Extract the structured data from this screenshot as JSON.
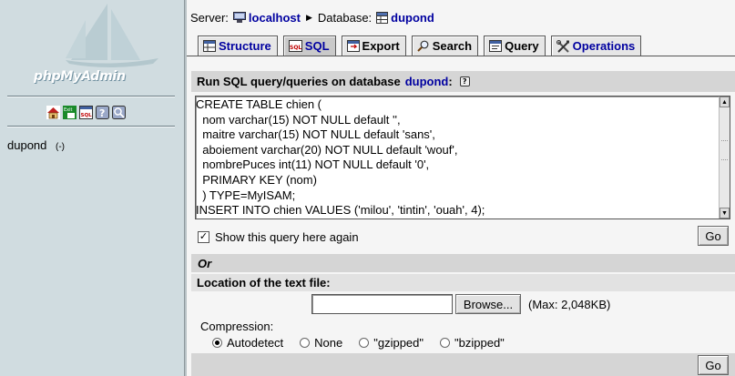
{
  "sidebar": {
    "logo_text": "phpMyAdmin",
    "icons": [
      "home-icon",
      "exit-icon",
      "sql-icon",
      "help-icon",
      "query-window-icon"
    ],
    "icon_labels": {
      "exit": "Exit",
      "sql": "SQL"
    },
    "db_name": "dupond",
    "db_count": "(-)"
  },
  "breadcrumb": {
    "server_label": "Server:",
    "server": "localhost",
    "database_label": "Database:",
    "database": "dupond"
  },
  "tabs": [
    {
      "label": "Structure",
      "icon": "structure-icon"
    },
    {
      "label": "SQL",
      "icon": "sql-icon",
      "active": true
    },
    {
      "label": "Export",
      "icon": "export-icon"
    },
    {
      "label": "Search",
      "icon": "search-icon"
    },
    {
      "label": "Query",
      "icon": "query-icon"
    },
    {
      "label": "Operations",
      "icon": "operations-icon"
    }
  ],
  "sql_panel": {
    "title": "Run SQL query/queries on database",
    "database": "dupond",
    "colon": ":",
    "help_glyph": "?",
    "query": "CREATE TABLE chien (\n  nom varchar(15) NOT NULL default '',\n  maitre varchar(15) NOT NULL default 'sans',\n  aboiement varchar(20) NOT NULL default 'wouf',\n  nombrePuces int(11) NOT NULL default '0',\n  PRIMARY KEY (nom)\n  ) TYPE=MyISAM;\nINSERT INTO chien VALUES ('milou', 'tintin', 'ouah', 4);",
    "show_again_label": "Show this query here again",
    "show_again_checked": true,
    "go_label": "Go"
  },
  "or_label": "Or",
  "upload": {
    "location_label": "Location of the text file:",
    "file_value": "",
    "browse_label": "Browse...",
    "max_label": "(Max: 2,048KB)",
    "compression_label": "Compression:",
    "options": [
      "Autodetect",
      "None",
      "\"gzipped\"",
      "\"bzipped\""
    ],
    "selected": "Autodetect",
    "go_label": "Go"
  },
  "colors": {
    "sidebar_bg": "#d0dce0",
    "link": "#0000a0",
    "content_bg": "#f5f5f5",
    "header_bar": "#d5d5d5"
  }
}
